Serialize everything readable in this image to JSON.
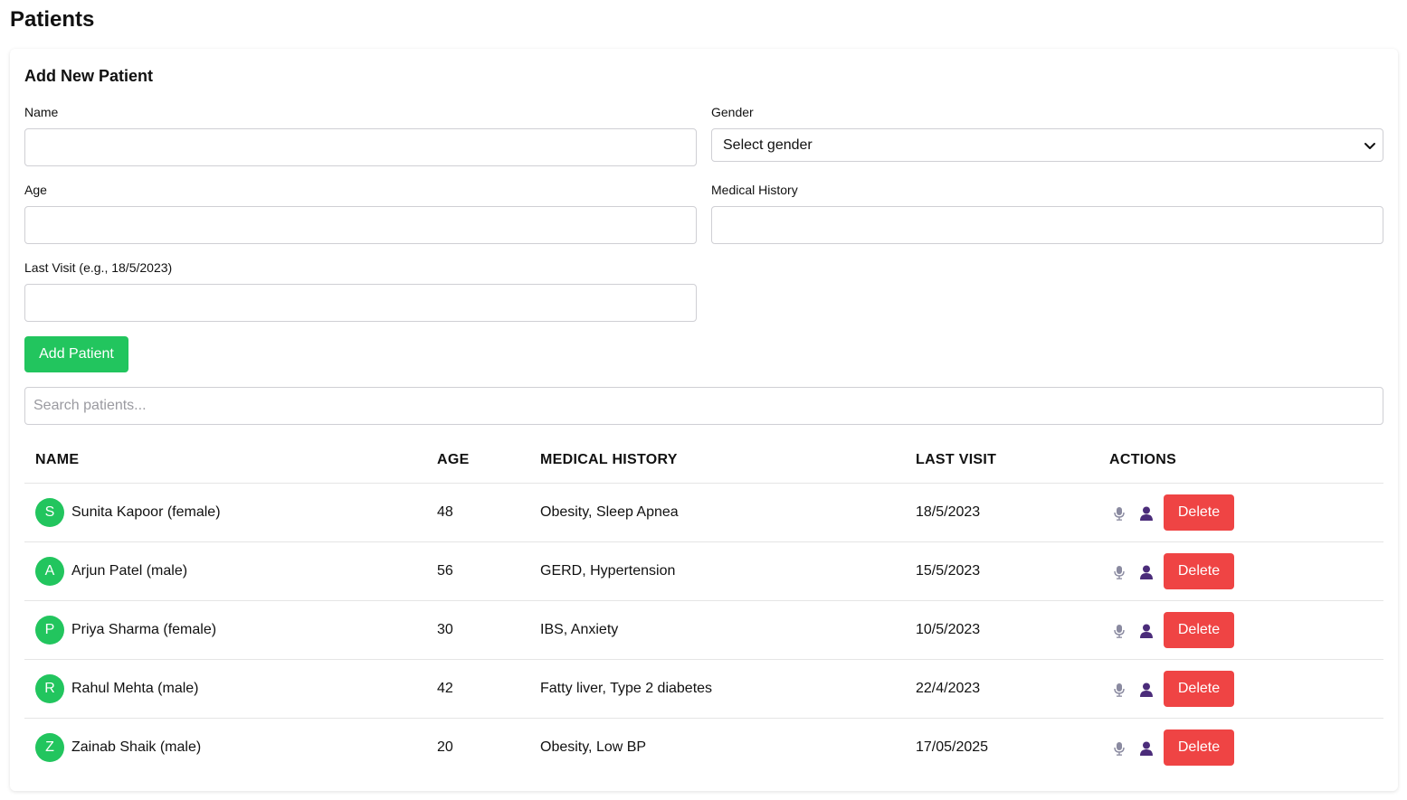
{
  "page": {
    "title": "Patients"
  },
  "form": {
    "title": "Add New Patient",
    "name_label": "Name",
    "name_value": "",
    "gender_label": "Gender",
    "gender_selected": "Select gender",
    "age_label": "Age",
    "age_value": "",
    "history_label": "Medical History",
    "history_value": "",
    "last_visit_label": "Last Visit (e.g., 18/5/2023)",
    "last_visit_value": "",
    "add_button_label": "Add Patient"
  },
  "search": {
    "placeholder": "Search patients..."
  },
  "table": {
    "headers": {
      "name": "NAME",
      "age": "AGE",
      "history": "MEDICAL HISTORY",
      "last_visit": "LAST VISIT",
      "actions": "ACTIONS"
    },
    "delete_label": "Delete",
    "rows": [
      {
        "initial": "S",
        "name": "Sunita Kapoor (female)",
        "age": "48",
        "history": "Obesity, Sleep Apnea",
        "last_visit": "18/5/2023"
      },
      {
        "initial": "A",
        "name": "Arjun Patel (male)",
        "age": "56",
        "history": "GERD, Hypertension",
        "last_visit": "15/5/2023"
      },
      {
        "initial": "P",
        "name": "Priya Sharma (female)",
        "age": "30",
        "history": "IBS, Anxiety",
        "last_visit": "10/5/2023"
      },
      {
        "initial": "R",
        "name": "Rahul Mehta (male)",
        "age": "42",
        "history": "Fatty liver, Type 2 diabetes",
        "last_visit": "22/4/2023"
      },
      {
        "initial": "Z",
        "name": "Zainab Shaik (male)",
        "age": "20",
        "history": "Obesity, Low BP",
        "last_visit": "17/05/2025"
      }
    ]
  },
  "colors": {
    "accent_green": "#22c55e",
    "delete_red": "#ef4444",
    "user_icon": "#4b2c7a"
  },
  "icons": {
    "row_action_1": "microphone-icon",
    "row_action_2": "user-profile-icon",
    "select": "chevron-down-icon"
  }
}
